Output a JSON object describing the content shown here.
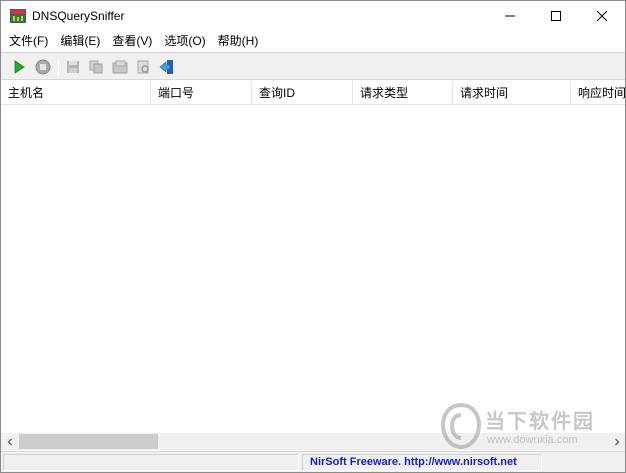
{
  "window": {
    "title": "DNSQuerySniffer"
  },
  "menu": {
    "items": [
      {
        "label": "文件(F)"
      },
      {
        "label": "编辑(E)"
      },
      {
        "label": "查看(V)"
      },
      {
        "label": "选项(O)"
      },
      {
        "label": "帮助(H)"
      }
    ]
  },
  "toolbar": {
    "buttons": [
      {
        "icon": "play-icon",
        "enabled": true
      },
      {
        "icon": "stop-icon",
        "enabled": false
      },
      {
        "icon": "save-icon",
        "enabled": false
      },
      {
        "icon": "copy-icon",
        "enabled": false
      },
      {
        "icon": "html-report-icon",
        "enabled": false
      },
      {
        "icon": "properties-icon",
        "enabled": false
      },
      {
        "icon": "exit-icon",
        "enabled": true
      }
    ]
  },
  "table": {
    "columns": [
      {
        "label": "主机名"
      },
      {
        "label": "端口号"
      },
      {
        "label": "查询ID"
      },
      {
        "label": "请求类型"
      },
      {
        "label": "请求时间"
      },
      {
        "label": "响应时间"
      }
    ],
    "rows": []
  },
  "statusbar": {
    "pane1": "",
    "link": "NirSoft Freeware.  http://www.nirsoft.net"
  },
  "watermark": {
    "brand": "当下软件园",
    "url": "www.downxia.com"
  },
  "colors": {
    "play_green": "#2ea82e",
    "link_blue": "#1a1acc",
    "toolbar_bg": "#f0f0f0"
  }
}
